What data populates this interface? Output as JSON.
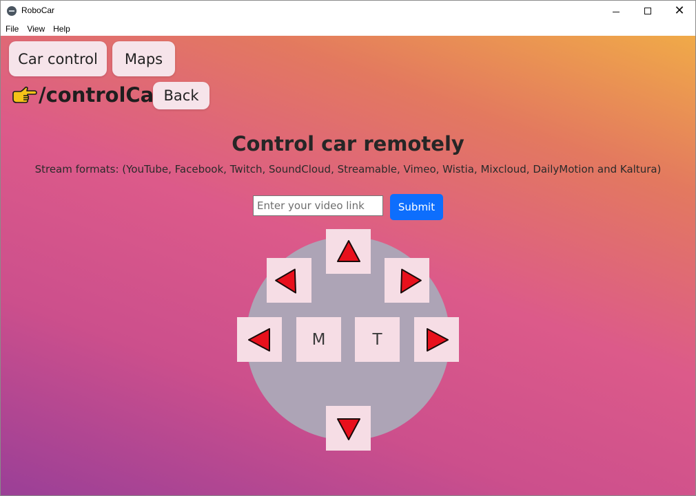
{
  "window": {
    "title": "RoboCar",
    "app_icon": "robocar-app-icon",
    "controls": {
      "minimize": "minimize-icon",
      "maximize": "maximize-icon",
      "close": "close-icon"
    }
  },
  "menu": {
    "items": [
      {
        "label": "File"
      },
      {
        "label": "View"
      },
      {
        "label": "Help"
      }
    ]
  },
  "nav": {
    "car_control_label": "Car control",
    "maps_label": "Maps"
  },
  "route": {
    "icon": "pointing-hand-icon",
    "path": "/controlCar",
    "back_label": "Back"
  },
  "main": {
    "heading": "Control car remotely",
    "subtitle": "Stream formats: (YouTube, Facebook, Twitch, SoundCloud, Streamable, Vimeo, Wistia, Mixcloud, DailyMotion and Kaltura)",
    "video_input_placeholder": "Enter your video link",
    "video_input_value": "",
    "submit_label": "Submit"
  },
  "joystick": {
    "m_label": "M",
    "t_label": "T",
    "arrow_color": "#e8101c"
  },
  "colors": {
    "gradient_top_right": "#f0aa48",
    "gradient_mid": "#dc5a8a",
    "gradient_bottom_left": "#9a3f97",
    "button_bg": "#f6e4ea",
    "submit_bg": "#0d6efd",
    "joystick_circle": "#ada4b6"
  }
}
